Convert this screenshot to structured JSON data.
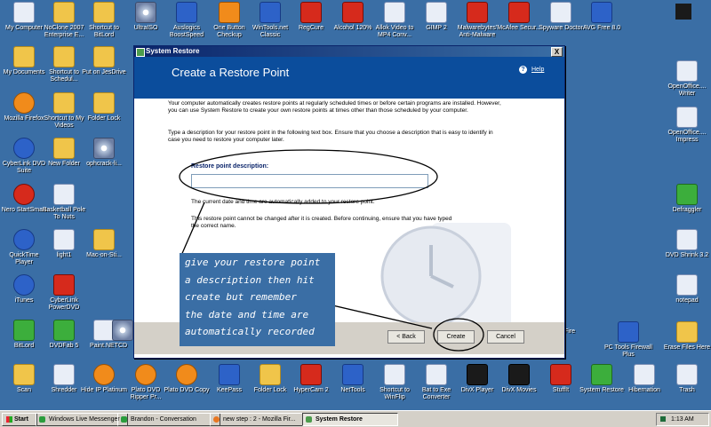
{
  "desktop": {
    "icons": [
      {
        "label": "My Computer",
        "icon": "computer-icon"
      },
      {
        "label": "NoClone 2007 Enterprise E...",
        "icon": "folder-icon"
      },
      {
        "label": "Shortcut to BitLord",
        "icon": "folder-icon"
      },
      {
        "label": "UltraISO",
        "icon": "disc-icon"
      },
      {
        "label": "Auslogics BoostSpeed",
        "icon": "gauge-icon"
      },
      {
        "label": "One Button Checkup",
        "icon": "checkup-icon"
      },
      {
        "label": "WinTools.net Classic",
        "icon": "tools-icon"
      },
      {
        "label": "RegCure",
        "icon": "regcure-icon"
      },
      {
        "label": "Alcohol 120%",
        "icon": "alcohol-icon"
      },
      {
        "label": "Allok Video to MP4 Conv...",
        "icon": "video-icon"
      },
      {
        "label": "GIMP 2",
        "icon": "gimp-icon"
      },
      {
        "label": "Malwarebytes' Anti-Malware",
        "icon": "malwarebytes-icon"
      },
      {
        "label": "McAfee Secur...",
        "icon": "mcafee-icon"
      },
      {
        "label": "Spyware Doctor",
        "icon": "spyware-doctor-icon"
      },
      {
        "label": "AVG Free 8.0",
        "icon": "avg-icon"
      },
      {
        "label": "My Documents",
        "icon": "documents-icon"
      },
      {
        "label": "Shortcut to Schedul...",
        "icon": "folder-icon"
      },
      {
        "label": "Put on JesDrive",
        "icon": "folder-icon"
      },
      {
        "label": "Mozilla Firefox",
        "icon": "firefox-icon"
      },
      {
        "label": "Shortcut to My Videos",
        "icon": "folder-icon"
      },
      {
        "label": "Folder Lock",
        "icon": "folder-icon"
      },
      {
        "label": "CyberLink DVD Suite",
        "icon": "cyberlink-icon"
      },
      {
        "label": "New Folder",
        "icon": "folder-icon"
      },
      {
        "label": "ophcrack-li...",
        "icon": "disc-icon"
      },
      {
        "label": "Nero StartSmart",
        "icon": "nero-icon"
      },
      {
        "label": "Basketball Pole To Nuts",
        "icon": "document-icon"
      },
      {
        "label": "QuickTime Player",
        "icon": "quicktime-icon"
      },
      {
        "label": "light1",
        "icon": "image-icon"
      },
      {
        "label": "Mac-on-Sti...",
        "icon": "folder-icon"
      },
      {
        "label": "iTunes",
        "icon": "itunes-icon"
      },
      {
        "label": "CyberLink PowerDVD",
        "icon": "powerdvd-icon"
      },
      {
        "label": "BitLord",
        "icon": "bitlord-icon"
      },
      {
        "label": "DVDFab 5",
        "icon": "dvdfab-icon"
      },
      {
        "label": "Paint.NET",
        "icon": "paintnet-icon"
      },
      {
        "label": "CD",
        "icon": "disc-icon"
      },
      {
        "label": "Scan",
        "icon": "folder-icon"
      },
      {
        "label": "Shredder",
        "icon": "shredder-icon"
      },
      {
        "label": "Hide IP Platinum",
        "icon": "hideip-icon"
      },
      {
        "label": "Plato DVD Ripper Pr...",
        "icon": "plato-icon"
      },
      {
        "label": "Plato DVD Copy",
        "icon": "plato-icon"
      },
      {
        "label": "KeePass",
        "icon": "keepass-icon"
      },
      {
        "label": "Folder Lock",
        "icon": "folder-icon"
      },
      {
        "label": "HyperCam 2",
        "icon": "hypercam-icon"
      },
      {
        "label": "NetTools",
        "icon": "nettools-icon"
      },
      {
        "label": "Shortcut to WinFlip",
        "icon": "winflip-icon"
      },
      {
        "label": "Bat to Exe Converter",
        "icon": "batexe-icon"
      },
      {
        "label": "DivX Player",
        "icon": "divx-icon"
      },
      {
        "label": "DivX Movies",
        "icon": "divx-icon"
      },
      {
        "label": "StuffIt",
        "icon": "stuffit-icon"
      },
      {
        "label": "System Restore",
        "icon": "system-restore-icon"
      },
      {
        "label": "Hibernation",
        "icon": "hibernation-icon"
      },
      {
        "label": "Trash",
        "icon": "trash-icon"
      },
      {
        "label": "OpenOffice.... Writer",
        "icon": "openoffice-writer-icon"
      },
      {
        "label": "OpenOffice.... Impress",
        "icon": "openoffice-impress-icon"
      },
      {
        "label": "Defraggler",
        "icon": "defraggler-icon"
      },
      {
        "label": "DVD Shrink 3.2",
        "icon": "dvdshrink-icon"
      },
      {
        "label": "notepad",
        "icon": "notepad-icon"
      },
      {
        "label": "Erase Files Here",
        "icon": "folder-icon"
      },
      {
        "label": "PC Tools Firewall Plus",
        "icon": "firewall-icon"
      },
      {
        "label": "tFire",
        "icon": "firewall-icon"
      }
    ]
  },
  "window": {
    "title": "System Restore",
    "header_title": "Create a Restore Point",
    "help_label": "Help",
    "close_label": "X",
    "intro": "Your computer automatically creates restore points at regularly scheduled times or before certain programs are installed. However, you can use System Restore to create your own restore points at times other than those scheduled by your computer.",
    "instruction": "Type a description for your restore point in the following text box. Ensure that you choose a description that is easy to identify in case you need to restore your computer later.",
    "desc_label": "Restore point description:",
    "desc_value": "",
    "date_note": "The current date and time are automatically added to your restore point.",
    "change_note": "This restore point cannot be changed after it is created. Before continuing, ensure that you have typed the correct name.",
    "back_label": "< Back",
    "create_label": "Create",
    "cancel_label": "Cancel"
  },
  "annotation": {
    "lines": [
      "give your restore point",
      "a description then hit",
      "create but remember",
      "the date and time are",
      "automatically recorded"
    ]
  },
  "taskbar": {
    "start_label": "Start",
    "tasks": [
      {
        "label": "Windows Live Messenger",
        "icon": "messenger-icon"
      },
      {
        "label": "Brandon - Conversation",
        "icon": "conversation-icon"
      },
      {
        "label": "new step : 2 - Mozilla Fir...",
        "icon": "firefox-icon"
      },
      {
        "label": "System Restore",
        "icon": "system-restore-icon"
      }
    ],
    "clock": "1:13 AM"
  },
  "colors": {
    "desktop_bg": "#3a6ea5",
    "header_bg": "#0b4d9c",
    "annotation_ink": "#ffffff"
  }
}
